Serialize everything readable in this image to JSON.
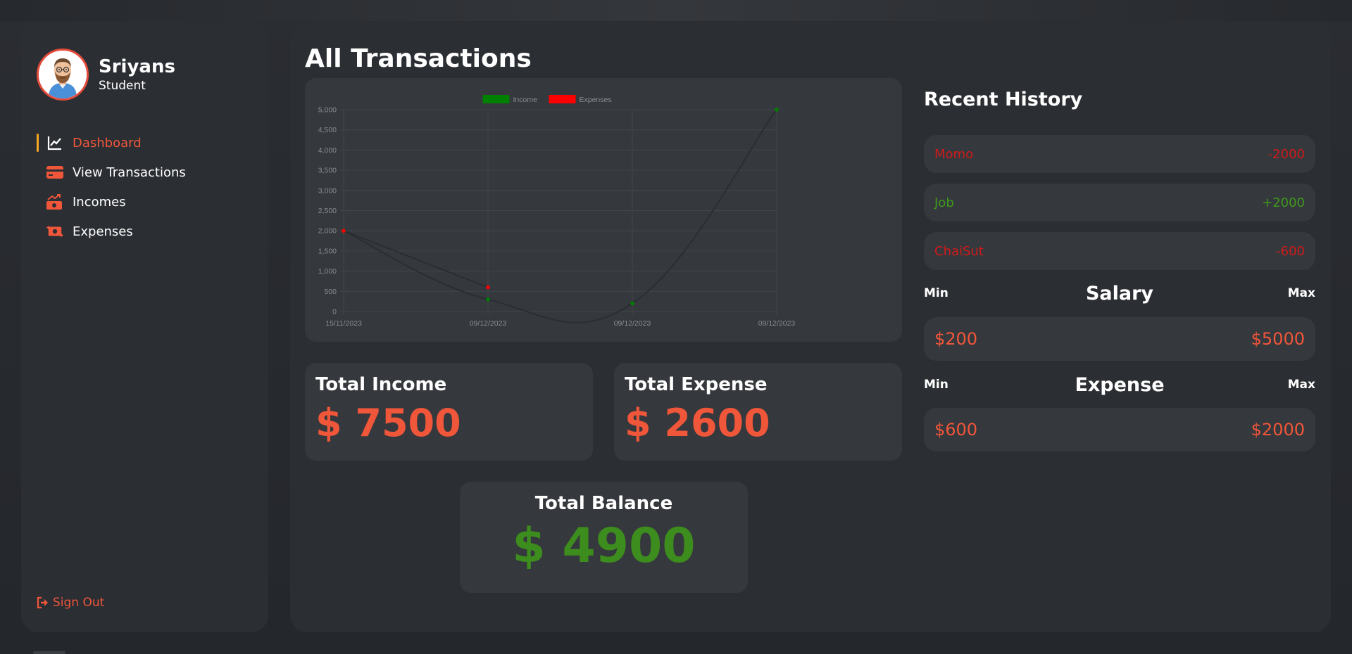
{
  "user": {
    "name": "Sriyans",
    "role": "Student"
  },
  "nav": {
    "items": [
      {
        "label": "Dashboard",
        "icon": "chart-line-icon"
      },
      {
        "label": "View Transactions",
        "icon": "credit-card-icon"
      },
      {
        "label": "Incomes",
        "icon": "money-bill-trend-icon"
      },
      {
        "label": "Expenses",
        "icon": "money-bill-transfer-icon"
      }
    ],
    "active": "Dashboard",
    "signout": "Sign Out"
  },
  "page": {
    "title": "All Transactions"
  },
  "chart_data": {
    "type": "line",
    "x": [
      "15/11/2023",
      "09/12/2023",
      "09/12/2023",
      "09/12/2023"
    ],
    "series": [
      {
        "name": "Income",
        "color": "#008000",
        "values": [
          2000,
          300,
          200,
          5000
        ]
      },
      {
        "name": "Expenses",
        "color": "#ff0000",
        "values": [
          2000,
          600,
          null,
          null
        ]
      }
    ],
    "ylim": [
      0,
      5000
    ],
    "yticks": [
      "0",
      "500",
      "1,000",
      "1,500",
      "2,000",
      "2,500",
      "3,000",
      "3,500",
      "4,000",
      "4,500",
      "5,000"
    ],
    "legend": "top-center",
    "grid": true
  },
  "stats": {
    "income": {
      "title": "Total Income",
      "value": "$ 7500"
    },
    "expense": {
      "title": "Total Expense",
      "value": "$ 2600"
    },
    "balance": {
      "title": "Total Balance",
      "value": "$ 4900"
    }
  },
  "history": {
    "title": "Recent History",
    "items": [
      {
        "name": "Momo",
        "amount": "-2000",
        "color": "#d11a1a"
      },
      {
        "name": "Job",
        "amount": "+2000",
        "color": "#3d9a1b"
      },
      {
        "name": "ChaiSut",
        "amount": "-600",
        "color": "#d11a1a"
      }
    ]
  },
  "salary": {
    "min_label": "Min",
    "title": "Salary",
    "max_label": "Max",
    "min": "$200",
    "max": "$5000"
  },
  "expense_range": {
    "min_label": "Min",
    "title": "Expense",
    "max_label": "Max",
    "min": "$600",
    "max": "$2000"
  },
  "colors": {
    "accent": "#f0563a",
    "panel": "#2b2e33",
    "card": "#35383c",
    "balance": "#3d8c1e",
    "active_bar": "#f5a623"
  }
}
